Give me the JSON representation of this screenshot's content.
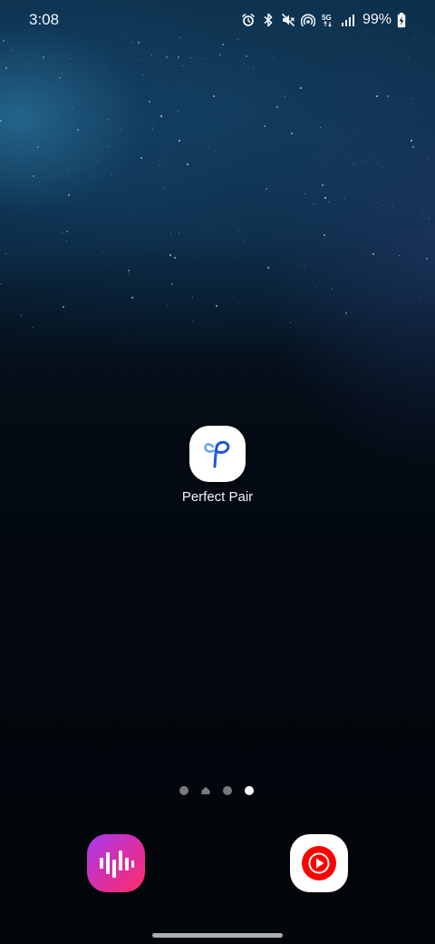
{
  "status_bar": {
    "time": "3:08",
    "battery_percent": "99%",
    "network_type": "5G",
    "icons": [
      "alarm-icon",
      "bluetooth-icon",
      "mute-icon",
      "hotspot-icon",
      "5g-icon",
      "signal-icon",
      "battery-charging-icon"
    ]
  },
  "home_screen": {
    "apps": [
      {
        "label": "Perfect Pair",
        "icon": "perfect-pair-icon"
      }
    ],
    "page_indicator": {
      "pages": 4,
      "home_page_index": 1,
      "current_page_index": 3
    }
  },
  "dock": {
    "apps": [
      {
        "name": "samsung-music",
        "icon": "samsung-music-icon"
      },
      {
        "name": "youtube-music",
        "icon": "youtube-music-icon"
      }
    ]
  },
  "colors": {
    "perfect_pair_blue": "#1f55d6",
    "youtube_red": "#ff0000",
    "music_gradient_start": "#a53cf0",
    "music_gradient_end": "#ff2d6a"
  }
}
